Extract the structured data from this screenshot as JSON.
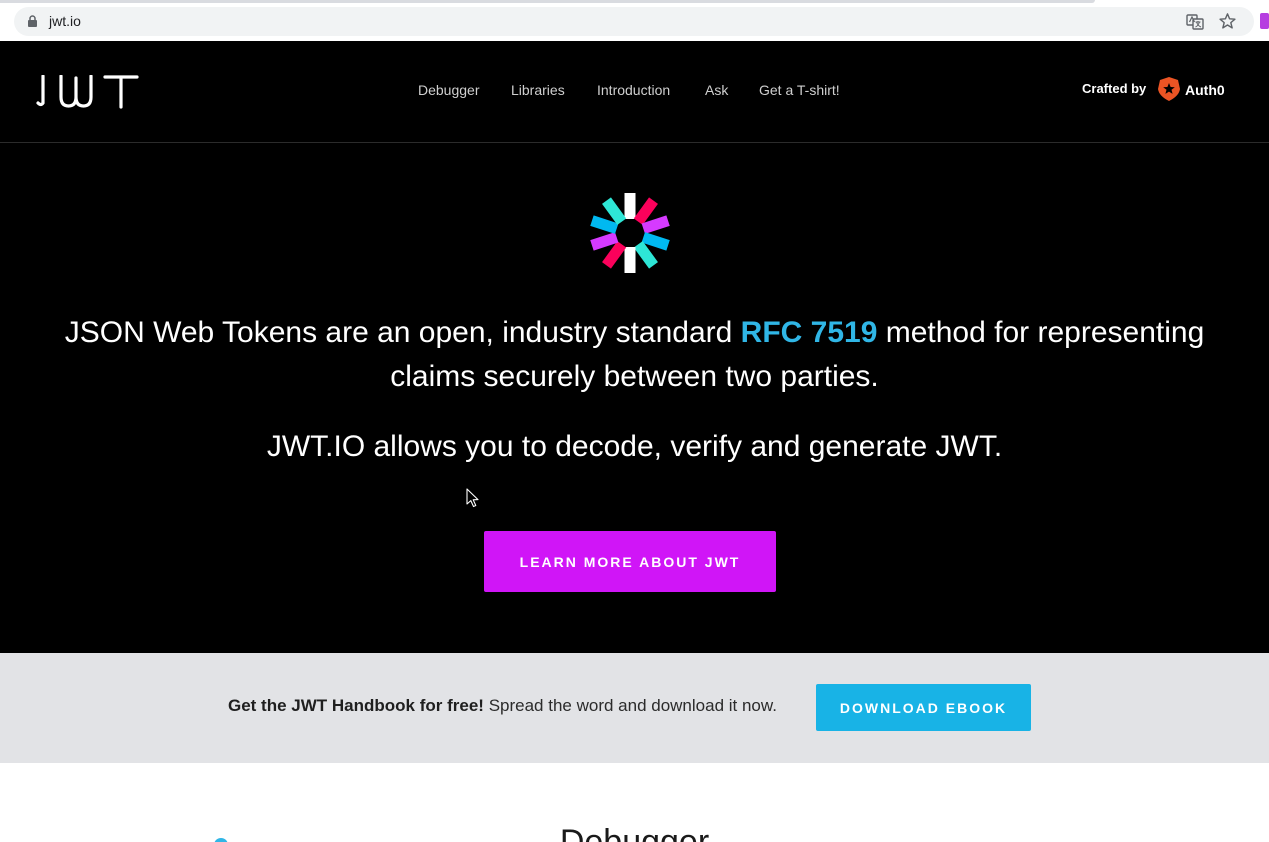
{
  "browser": {
    "url": "jwt.io"
  },
  "nav": {
    "logo_text": "JWT",
    "links": [
      "Debugger",
      "Libraries",
      "Introduction",
      "Ask",
      "Get a T-shirt!"
    ],
    "crafted_by": "Crafted by",
    "brand": "Auth0"
  },
  "hero": {
    "headline_before": "JSON Web Tokens are an open, industry standard ",
    "headline_link": "RFC 7519",
    "headline_after": " method for representing claims securely between two parties.",
    "subheadline": "JWT.IO allows you to decode, verify and generate JWT.",
    "cta_label": "LEARN MORE ABOUT JWT"
  },
  "ebook": {
    "bold_text": "Get the JWT Handbook for free!",
    "text": " Spread the word and download it now.",
    "button_label": "DOWNLOAD EBOOK"
  },
  "debugger": {
    "title": "Debugger"
  },
  "colors": {
    "link_blue": "#30b6e6",
    "cta_magenta": "#d015f7",
    "download_blue": "#18b3e6",
    "logo_pink": "#fb015b",
    "logo_purple": "#d63aff",
    "logo_cyan": "#00b9f1",
    "logo_teal": "#2ee6d6",
    "auth0_red": "#eb5424"
  }
}
